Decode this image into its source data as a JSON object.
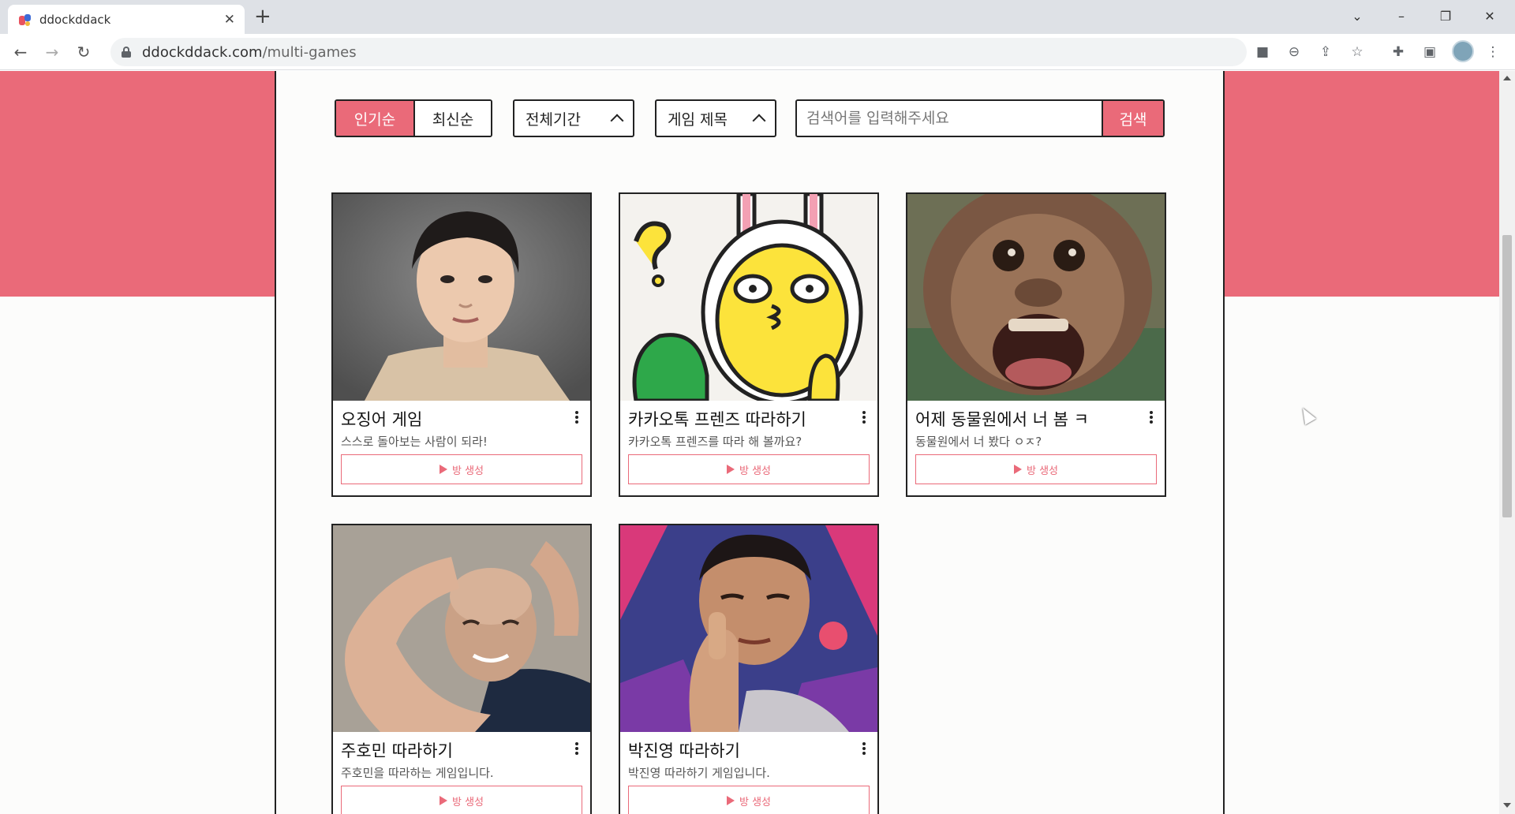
{
  "browser": {
    "tab_title": "ddockddack",
    "tab_close": "✕",
    "new_tab": "+",
    "url_domain": "ddockddack.com",
    "url_path": "/multi-games"
  },
  "filters": {
    "sort_popular": "인기순",
    "sort_latest": "최신순",
    "period": "전체기간",
    "search_field": "게임 제목",
    "search_placeholder": "검색어를 입력해주세요",
    "search_button": "검색"
  },
  "games": [
    {
      "title": "오징어 게임",
      "description": "스스로 돌아보는 사람이 되라!",
      "button": "방 생성",
      "thumbnail": "portrait-man-beige-shirt"
    },
    {
      "title": "카카오톡 프렌즈 따라하기",
      "description": "카카오톡 프렌즈를 따라 해 볼까요?",
      "button": "방 생성",
      "thumbnail": "yellow-bunny-character"
    },
    {
      "title": "어제 동물원에서 너 봄 ㅋ",
      "description": "동물원에서 너 봤다 ㅇㅈ?",
      "button": "방 생성",
      "thumbnail": "orangutan-face"
    },
    {
      "title": "주호민 따라하기",
      "description": "주호민을 따라하는 게임입니다.",
      "button": "방 생성",
      "thumbnail": "man-hand-frame"
    },
    {
      "title": "박진영 따라하기",
      "description": "박진영 따라하기 게임입니다.",
      "button": "방 생성",
      "thumbnail": "man-finger-heart"
    }
  ],
  "colors": {
    "brand": "#ea6a79",
    "border": "#222222"
  }
}
